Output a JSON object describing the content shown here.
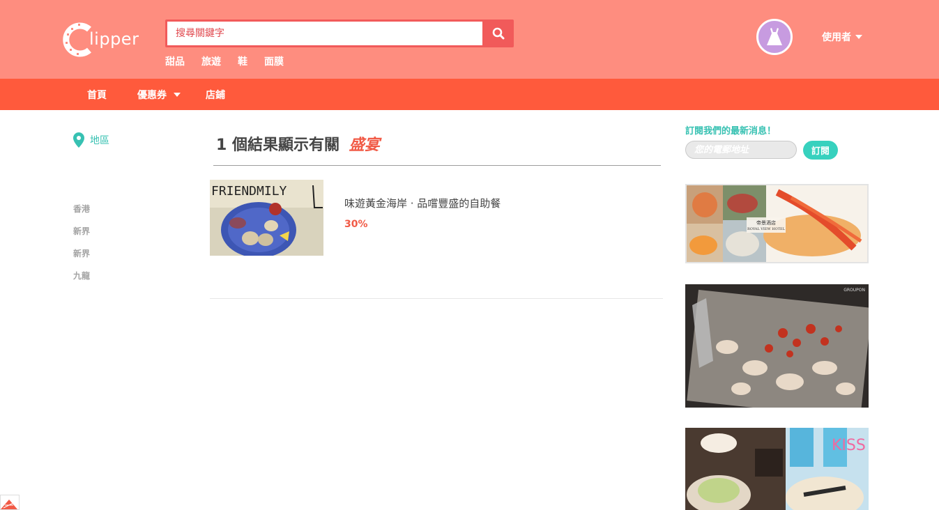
{
  "header": {
    "logo_text": "lipper",
    "search_placeholder": "搜尋關鍵字",
    "quick_links": [
      "甜品",
      "旅遊",
      "鞋",
      "面膜"
    ],
    "user_label": "使用者"
  },
  "nav": {
    "home": "首頁",
    "coupons": "優惠券",
    "stores": "店鋪"
  },
  "sidebar": {
    "region_label": "地區",
    "regions": [
      "香港",
      "新界",
      "新界",
      "九龍"
    ]
  },
  "results": {
    "count": "1",
    "heading_text": "個結果顯示有關",
    "keyword": "盛宴",
    "items": [
      {
        "title": "味遊黃金海岸 · 品嚐豐盛的自助餐",
        "discount": "30%",
        "image_text": "FRIENDMILY"
      }
    ]
  },
  "subscribe": {
    "title": "訂閱我們的最新消息！",
    "email_placeholder": "您的電郵地址",
    "button": "訂閱"
  },
  "ads": {
    "ad1_text": "帝景酒店",
    "ad1_sub": "ROYAL VIEW HOTEL",
    "ad2_text": "GROUPON",
    "ad3_text": "KISS"
  },
  "colors": {
    "header_bg": "#fe8d7f",
    "nav_bg": "#ff5a3c",
    "accent_teal": "#37c1b2",
    "accent_red": "#f15a46"
  }
}
